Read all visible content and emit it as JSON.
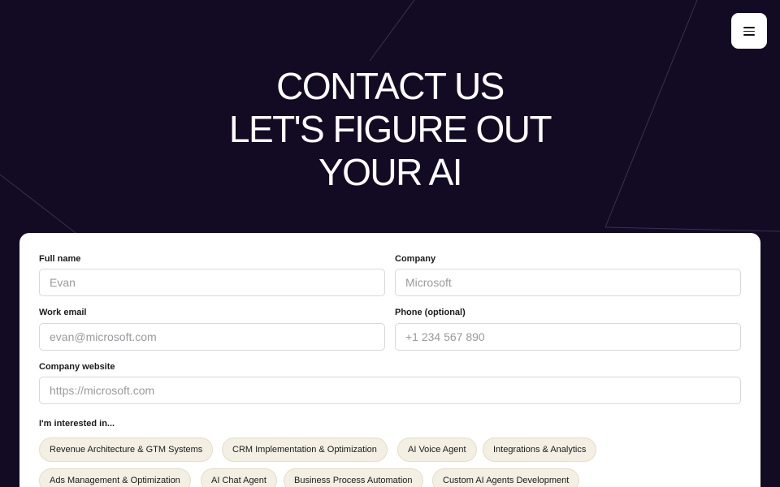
{
  "header": {
    "menu_icon": "hamburger-icon",
    "hero_lines": [
      "CONTACT US",
      "LET'S FIGURE OUT",
      "YOUR AI"
    ]
  },
  "form": {
    "full_name": {
      "label": "Full name",
      "placeholder": "Evan"
    },
    "company": {
      "label": "Company",
      "placeholder": "Microsoft"
    },
    "work_email": {
      "label": "Work email",
      "placeholder": "evan@microsoft.com"
    },
    "phone": {
      "label": "Phone (optional)",
      "placeholder": "+1 234 567 890"
    },
    "website": {
      "label": "Company website",
      "placeholder": "https://microsoft.com"
    },
    "interests_label": "I'm interested in...",
    "interests": [
      "Revenue Architecture & GTM Systems",
      "CRM Implementation & Optimization",
      "AI Voice Agent",
      "Integrations & Analytics",
      "Ads Management & Optimization",
      "AI Chat Agent",
      "Business Process Automation",
      "Custom AI Agents Development"
    ]
  },
  "colors": {
    "background": "#130a24",
    "card": "#ffffff",
    "chip": "#f4efe3"
  }
}
